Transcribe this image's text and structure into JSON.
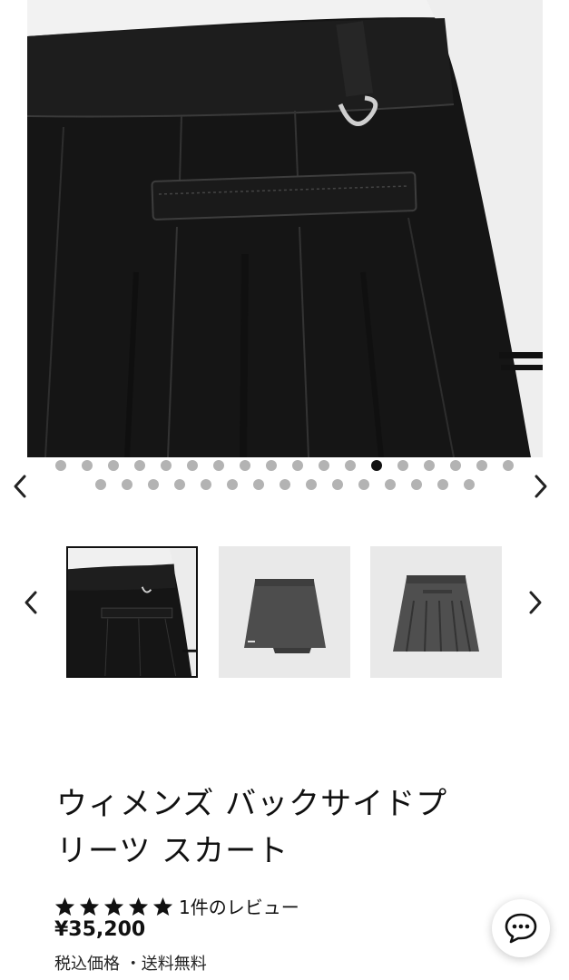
{
  "product": {
    "title_line1": "ウィメンズ バックサイドプ",
    "title_line2": "リーツ スカート",
    "review_text": "1件のレビュー",
    "rating": 5,
    "price": "¥35,200",
    "tax_note": "税込価格 ・送料無料"
  },
  "gallery": {
    "total_images": 33,
    "active_index": 12
  },
  "icons": {
    "prev": "chevron-left-icon",
    "next": "chevron-right-icon",
    "star": "star-icon",
    "chat": "chat-bubble-icon"
  },
  "colors": {
    "text": "#111111",
    "dot_inactive": "#b3b3b3",
    "dot_active": "#111111",
    "thumb_bg": "#eaeaea"
  }
}
